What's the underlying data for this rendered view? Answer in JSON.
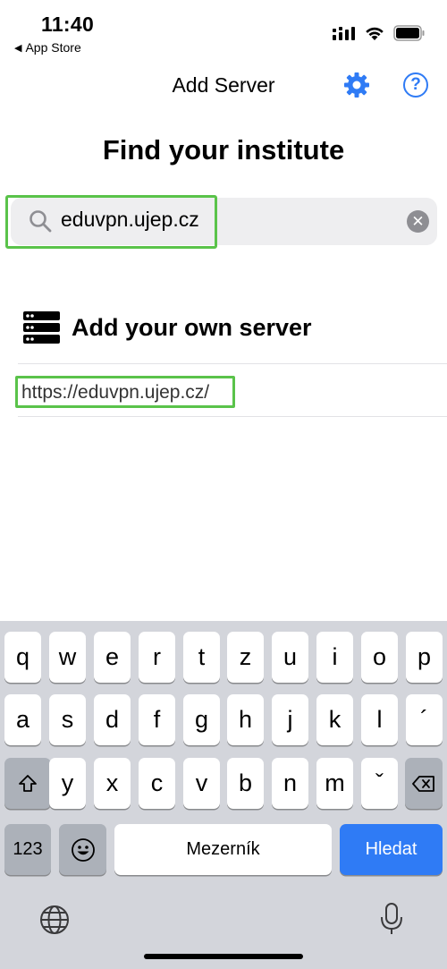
{
  "status_bar": {
    "time": "11:40",
    "back_app_label": "App Store",
    "icons": [
      "signal-icon",
      "wifi-icon",
      "battery-icon"
    ]
  },
  "nav": {
    "title": "Add Server",
    "icons": [
      "gear-icon",
      "help-icon"
    ],
    "help_glyph": "?"
  },
  "heading": "Find your institute",
  "search": {
    "value": "eduvpn.ujep.cz",
    "clear_glyph": "✕"
  },
  "own_server": {
    "label": "Add your own server",
    "url": "https://eduvpn.ujep.cz/"
  },
  "keyboard": {
    "row1": [
      "q",
      "w",
      "e",
      "r",
      "t",
      "z",
      "u",
      "i",
      "o",
      "p"
    ],
    "row2": [
      "a",
      "s",
      "d",
      "f",
      "g",
      "h",
      "j",
      "k",
      "l",
      "´"
    ],
    "row3": [
      "y",
      "x",
      "c",
      "v",
      "b",
      "n",
      "m",
      "ˇ"
    ],
    "numbers_label": "123",
    "space_label": "Mezerník",
    "search_label": "Hledat",
    "icons": [
      "shift-icon",
      "backspace-icon",
      "emoji-icon",
      "globe-icon",
      "mic-icon"
    ]
  },
  "colors": {
    "accent": "#2f7bf5",
    "highlight": "#5ac34a"
  }
}
